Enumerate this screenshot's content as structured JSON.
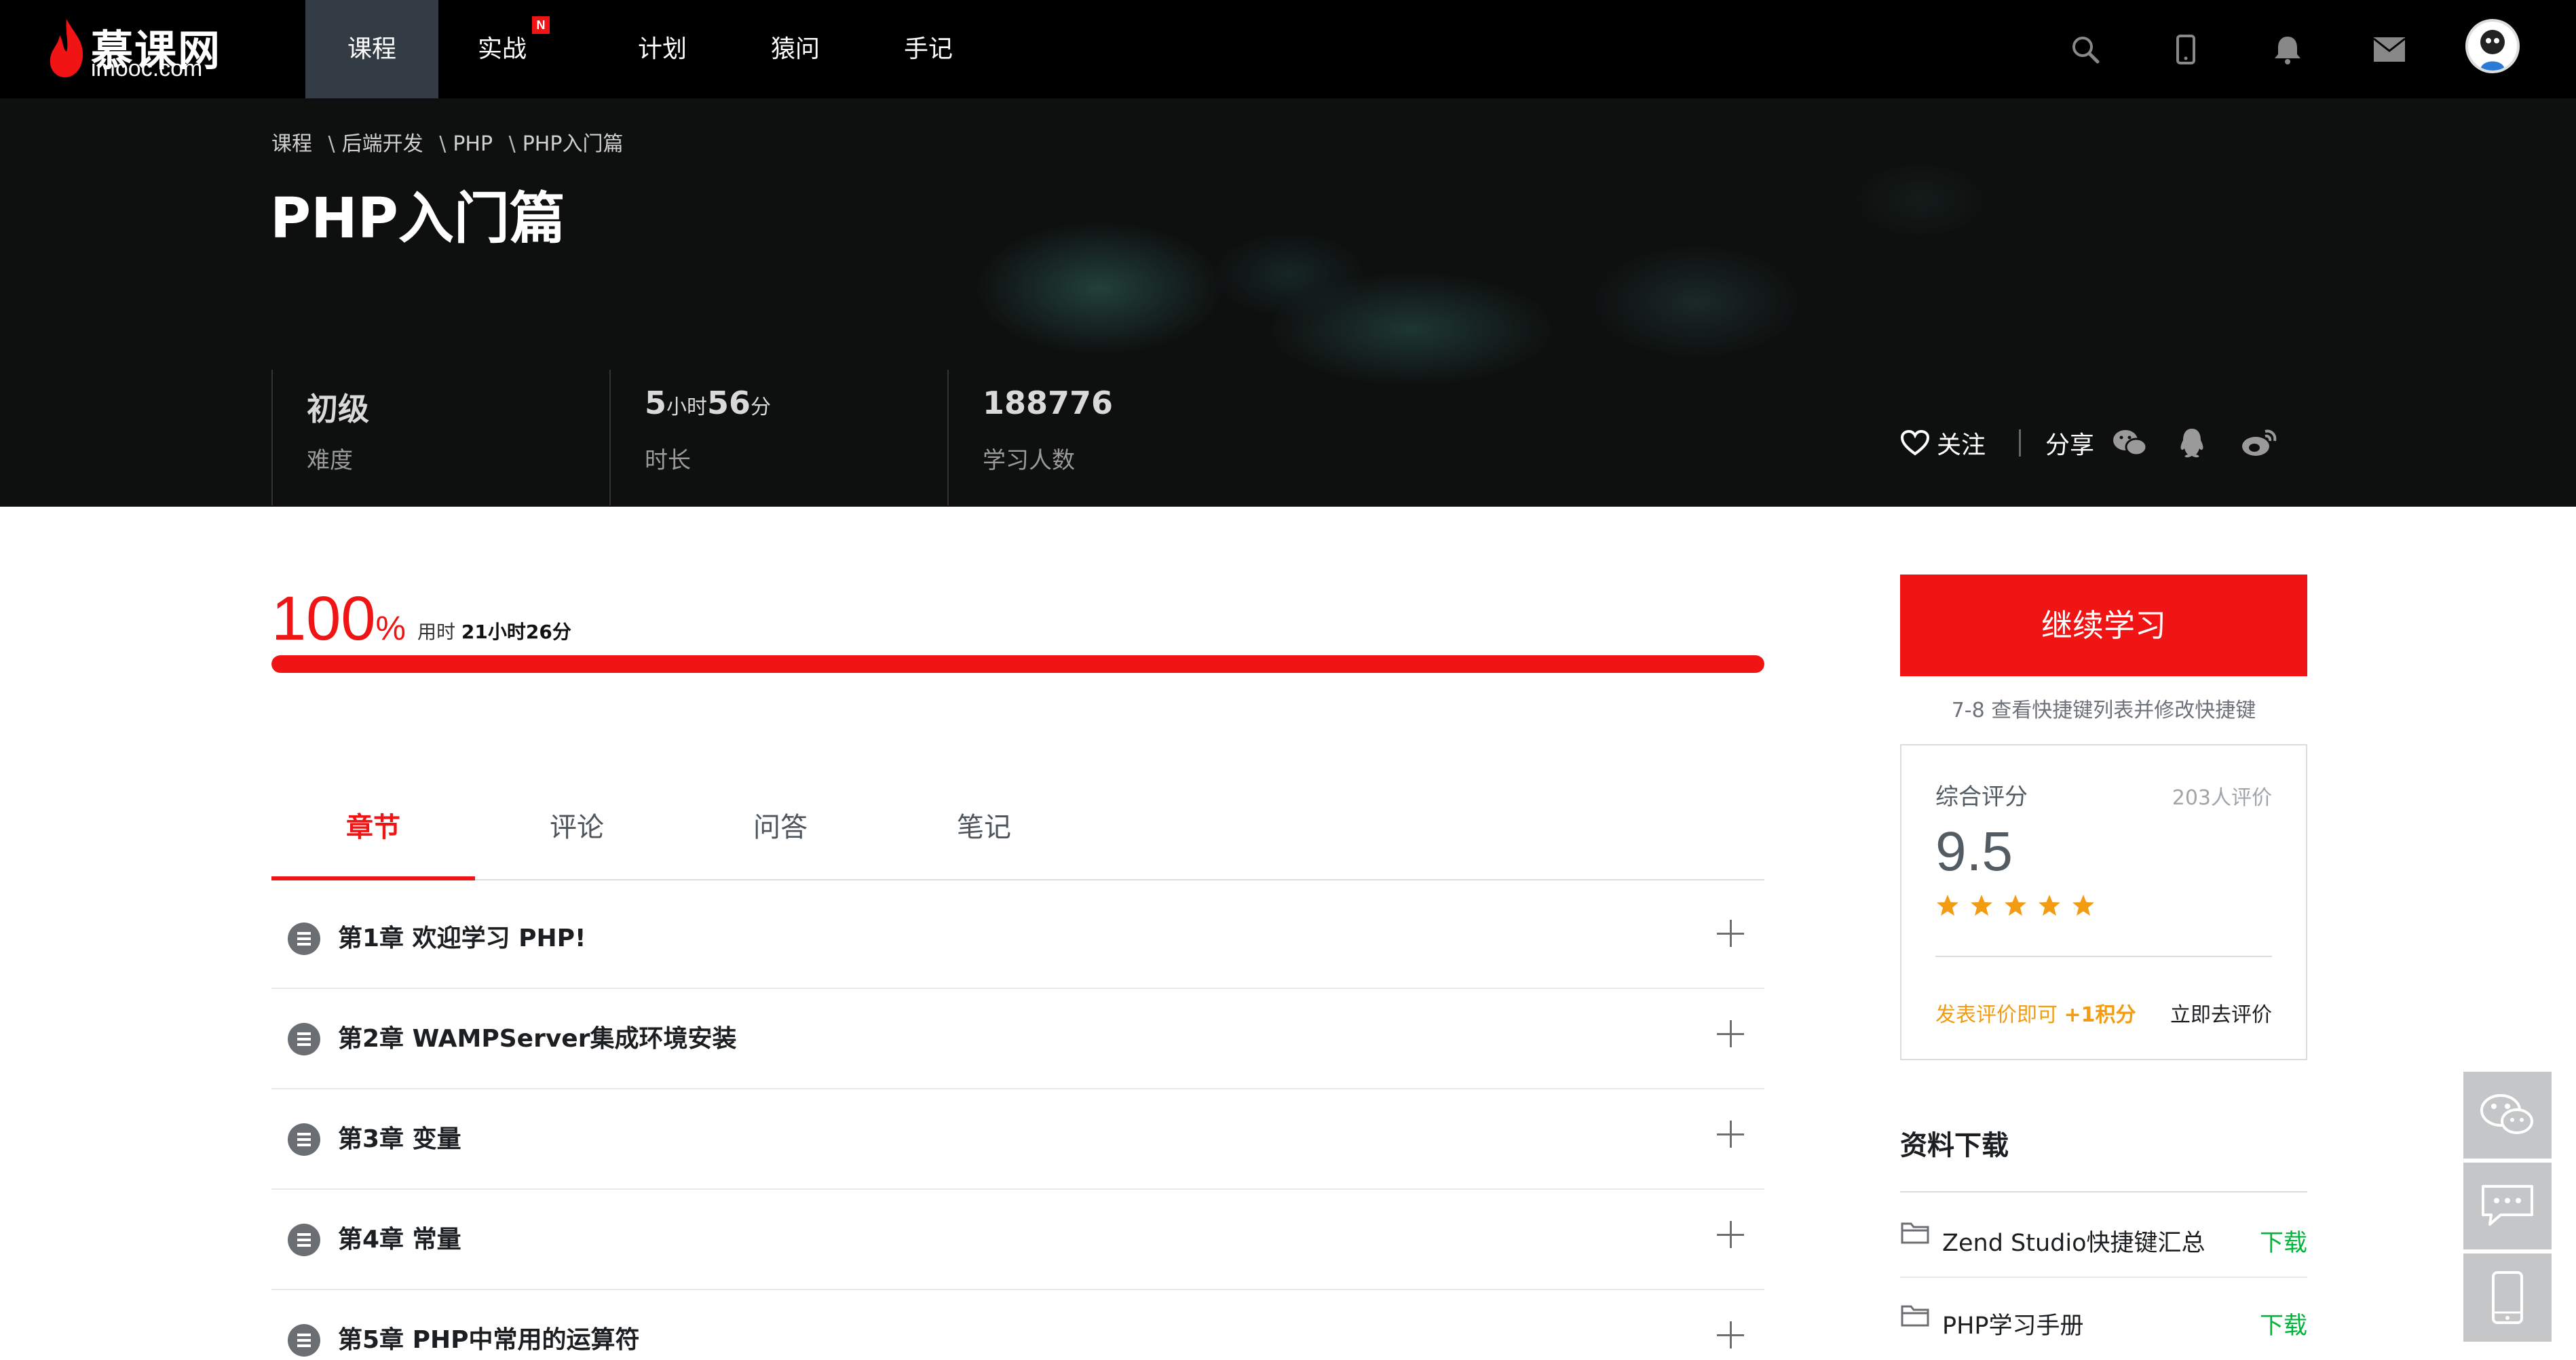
{
  "brand": {
    "logo_cn": "慕课网",
    "logo_en": "imooc.com"
  },
  "nav": {
    "items": [
      {
        "label": "课程"
      },
      {
        "label": "实战",
        "badge": "N"
      },
      {
        "label": "计划"
      },
      {
        "label": "猿问"
      },
      {
        "label": "手记"
      }
    ],
    "active_index": 0
  },
  "top_icons": [
    "search-icon",
    "mobile-icon",
    "bell-icon",
    "mail-icon",
    "avatar"
  ],
  "breadcrumb": [
    "课程",
    "后端开发",
    "PHP",
    "PHP入门篇"
  ],
  "breadcrumb_separator": "\\",
  "course": {
    "title": "PHP入门篇",
    "difficulty": {
      "value": "初级",
      "label": "难度"
    },
    "duration": {
      "hours": "5",
      "hours_unit": "小时",
      "minutes": "56",
      "minutes_unit": "分",
      "label": "时长"
    },
    "learners": {
      "value": "188776",
      "label": "学习人数"
    }
  },
  "social": {
    "follow": "关注",
    "share": "分享",
    "share_icons": [
      "wechat-icon",
      "qq-icon",
      "weibo-icon"
    ]
  },
  "progress": {
    "percent": 100,
    "percent_num": "100",
    "percent_sign": "%",
    "time_prefix": "用时",
    "time_value": "21小时26分"
  },
  "tabs": [
    "章节",
    "评论",
    "问答",
    "笔记"
  ],
  "active_tab": 0,
  "chapters": [
    "第1章 欢迎学习 PHP!",
    "第2章 WAMPServer集成环境安装",
    "第3章 变量",
    "第4章 常量",
    "第5章 PHP中常用的运算符"
  ],
  "sidebar": {
    "continue_label": "继续学习",
    "shortcut_hint": "7-8 查看快捷键列表并修改快捷键",
    "rating": {
      "heading": "综合评分",
      "count_text": "203人评价",
      "score": "9.5",
      "stars": 5,
      "earn_prefix": "发表评价即可",
      "earn_bonus": "+1积分",
      "go_label": "立即去评价"
    },
    "downloads_heading": "资料下载",
    "downloads": [
      {
        "name": "Zend Studio快捷键汇总",
        "action": "下载"
      },
      {
        "name": "PHP学习手册",
        "action": "下载"
      }
    ]
  },
  "float_tools": [
    "wechat-icon",
    "feedback-icon",
    "mobile-app-icon"
  ],
  "colors": {
    "accent": "#f01414",
    "topbar": "#000000",
    "download": "#00b43c",
    "star": "#f39c12"
  }
}
